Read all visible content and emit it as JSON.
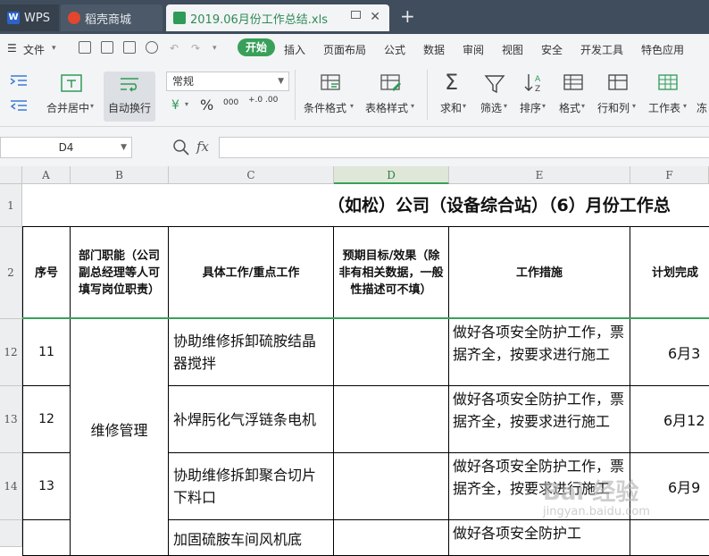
{
  "tabs": {
    "wps": "WPS",
    "shop": "稻壳商城",
    "file": "2019.06月份工作总结.xls"
  },
  "menu": {
    "file": "文件",
    "items": [
      "开始",
      "插入",
      "页面布局",
      "公式",
      "数据",
      "审阅",
      "视图",
      "安全",
      "开发工具",
      "特色应用"
    ]
  },
  "ribbon": {
    "merge_center": "合并居中",
    "wrap_text": "自动换行",
    "number_format": "常规",
    "decimal_inc": "+.0 .00",
    "conditional_format": "条件格式",
    "table_style": "表格样式",
    "sum": "求和",
    "filter": "筛选",
    "sort": "排序",
    "format": "格式",
    "row_col": "行和列",
    "worksheet": "工作表",
    "freeze": "冻"
  },
  "formula_bar": {
    "cell_ref": "D4",
    "fx": "fx",
    "value": ""
  },
  "columns": [
    "A",
    "B",
    "C",
    "D",
    "E",
    "F"
  ],
  "sheet": {
    "title": "（如松）公司（设备综合站）（6）月份工作总",
    "headers": {
      "seq": "序号",
      "dept": "部门职能（公司副总经理等人可填写岗位职责）",
      "work": "具体工作/重点工作",
      "goal": "预期目标/效果（除非有相关数据，一般性描述可不填）",
      "measures": "工作措施",
      "plan": "计划完成"
    },
    "row_numbers": [
      "1",
      "2",
      "12",
      "13",
      "14"
    ],
    "dept_merged": "维修管理",
    "rows": [
      {
        "seq": "11",
        "work": "协助维修拆卸硫胺结晶器搅拌",
        "measures": "做好各项安全防护工作，票据齐全，按要求进行施工",
        "plan": "6月3"
      },
      {
        "seq": "12",
        "work": "补焊肟化气浮链条电机",
        "measures": "做好各项安全防护工作，票据齐全，按要求进行施工",
        "plan": "6月12"
      },
      {
        "seq": "13",
        "work": "协助维修拆卸聚合切片下料口",
        "measures": "做好各项安全防护工作，票据齐全，按要求进行施工",
        "plan": "6月9"
      },
      {
        "seq": "",
        "work": "加固硫胺车间风机底",
        "measures": "做好各项安全防护工",
        "plan": ""
      }
    ]
  },
  "watermark": {
    "text": "Bai 经验",
    "sub": "jingyan.baidu.com"
  },
  "colors": {
    "accent": "#39a05a",
    "tabbar": "#3f4d5c",
    "ribbon_bg": "#f3f4f6"
  }
}
